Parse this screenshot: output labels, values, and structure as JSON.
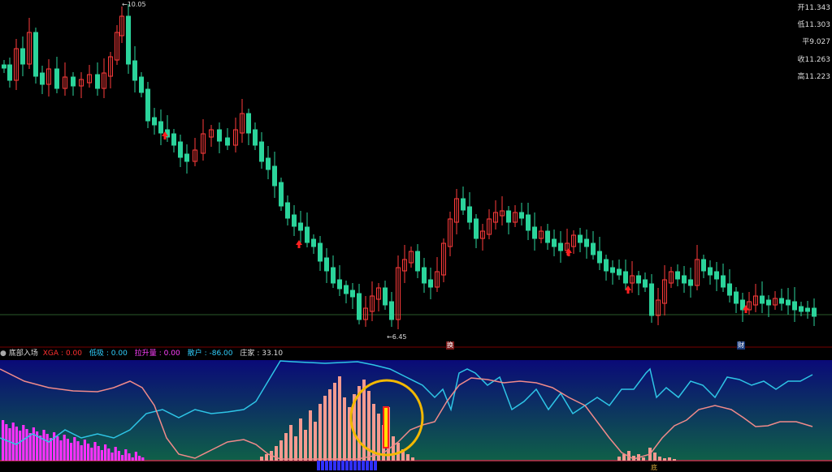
{
  "chart_data": {
    "type": "candlestick",
    "annotations": {
      "high": "10.05",
      "low": "6.45"
    },
    "price_panel": {
      "ylim": [
        6.3,
        10.1
      ],
      "side_labels": [
        {
          "label": "开",
          "value": "11.343"
        },
        {
          "label": "低",
          "value": "11.303"
        },
        {
          "label": "平",
          "value": "9.027"
        },
        {
          "label": "收",
          "value": "11.263"
        },
        {
          "label": "高",
          "value": "11.223"
        }
      ],
      "markers": [
        "换",
        "财"
      ]
    },
    "indicator": {
      "name": "底部入场",
      "values": [
        {
          "label": "XGA",
          "value": "0.00",
          "color": "#ff3030"
        },
        {
          "label": "低吸",
          "value": "0.00",
          "color": "#30d0ff"
        },
        {
          "label": "拉升量",
          "value": "0.00",
          "color": "#ff40ff"
        },
        {
          "label": "散户",
          "value": "-86.00",
          "color": "#30d0ff"
        },
        {
          "label": "庄家",
          "value": "33.10",
          "color": "#dddddd"
        }
      ],
      "markers": [
        "底"
      ]
    },
    "colors": {
      "up": "#ff3b3b",
      "down": "#2bd49b",
      "retail_line": "#2ec5e6",
      "main_line": "#f08a8a"
    }
  }
}
